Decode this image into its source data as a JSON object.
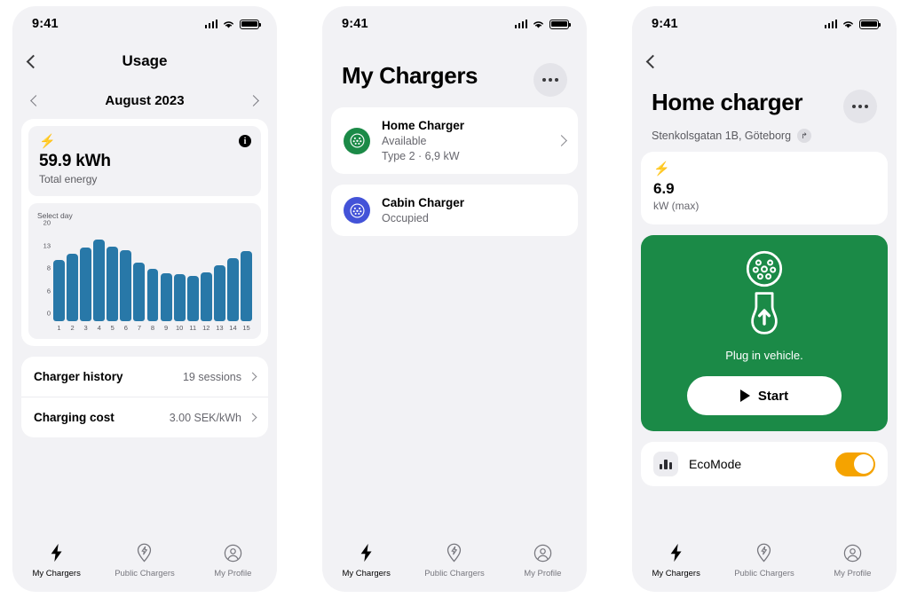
{
  "status_bar": {
    "time": "9:41",
    "icons": [
      "signal-icon",
      "wifi-icon",
      "battery-icon"
    ]
  },
  "colors": {
    "page_bg": "#ffffff",
    "phone_bg": "#f2f2f5",
    "card_bg": "#ffffff",
    "brand_green": "#1b8a47",
    "connector_blue": "#4353d8",
    "bar_blue": "#2878a8",
    "toggle_orange": "#f5a300",
    "muted_text": "#67676e"
  },
  "tab_bar": {
    "items": [
      {
        "label": "My Chargers",
        "icon": "bolt-icon",
        "active": true
      },
      {
        "label": "Public Chargers",
        "icon": "map-pin-bolt-icon",
        "active": false
      },
      {
        "label": "My Profile",
        "icon": "person-circle-icon",
        "active": false
      }
    ]
  },
  "screen_usage": {
    "nav": {
      "back_icon": "chevron-left-icon",
      "title": "Usage"
    },
    "month_selector": {
      "prev_icon": "chevron-left-icon",
      "label": "August 2023",
      "next_icon": "chevron-right-icon"
    },
    "energy": {
      "icon": "bolt-icon",
      "info_icon": "info-icon",
      "value": "59.9 kWh",
      "label": "Total energy"
    },
    "chart_hint": "Select day",
    "rows": [
      {
        "label": "Charger history",
        "value": "19 sessions",
        "chevron": "chevron-right-icon"
      },
      {
        "label": "Charging cost",
        "value": "3.00 SEK/kWh",
        "chevron": "chevron-right-icon"
      }
    ]
  },
  "chart_data": {
    "type": "bar",
    "title": "Select day",
    "xlabel": "",
    "ylabel": "",
    "categories": [
      "1",
      "2",
      "3",
      "4",
      "5",
      "6",
      "7",
      "8",
      "9",
      "10",
      "11",
      "12",
      "13",
      "14",
      "15"
    ],
    "values": [
      13.5,
      15.0,
      16.3,
      18.0,
      16.4,
      15.6,
      13.0,
      11.5,
      10.5,
      10.3,
      10.0,
      10.7,
      12.4,
      14.0,
      15.5
    ],
    "ytick_labels": [
      "20",
      "13",
      "8",
      "6",
      "0"
    ],
    "ytick_positions_pct": [
      100,
      75,
      50,
      25,
      0
    ],
    "ylim": [
      0,
      20
    ],
    "grid": false,
    "legend": false,
    "bar_color": "#2878a8"
  },
  "screen_chargers": {
    "title": "My Chargers",
    "more_icon": "ellipsis-icon",
    "items": [
      {
        "name": "Home Charger",
        "status": "Available",
        "meta": "Type 2  ·  6,9 kW",
        "icon": "type2-connector-icon",
        "icon_color": "#1b8a47",
        "chevron": "chevron-right-icon"
      },
      {
        "name": "Cabin Charger",
        "status": "Occupied",
        "meta": "",
        "icon": "type2-connector-icon",
        "icon_color": "#4353d8",
        "chevron": ""
      }
    ]
  },
  "screen_home_charger": {
    "nav": {
      "back_icon": "chevron-left-icon"
    },
    "title": "Home charger",
    "address": "Stenkolsgatan 1B, Göteborg",
    "address_badge_icon": "navigate-arrow-icon",
    "more_icon": "ellipsis-icon",
    "power": {
      "icon": "bolt-icon",
      "value": "6.9",
      "unit": "kW (max)"
    },
    "plug_panel": {
      "socket_icon": "type2-socket-icon",
      "plug_icon": "plug-up-arrow-icon",
      "caption": "Plug in vehicle.",
      "start_button": {
        "label": "Start",
        "icon": "play-icon"
      }
    },
    "eco": {
      "icon": "bar-chart-icon",
      "label": "EcoMode",
      "toggle_on": true
    }
  }
}
